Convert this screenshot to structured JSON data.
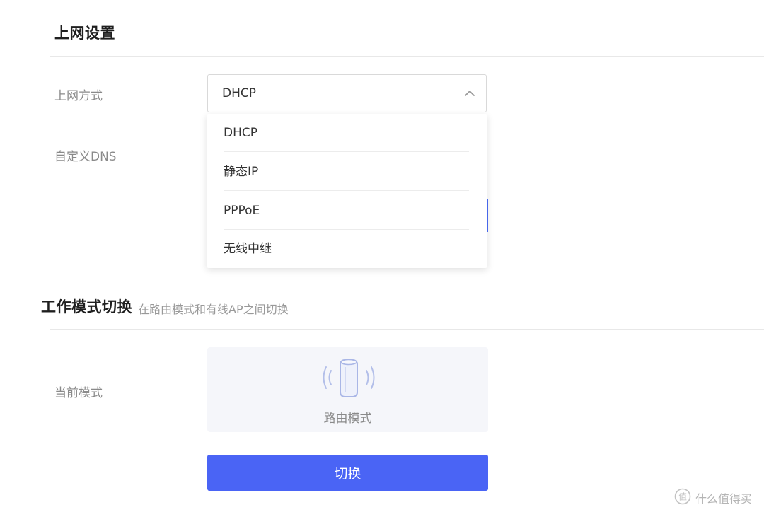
{
  "internet_settings": {
    "title": "上网设置",
    "connection_type": {
      "label": "上网方式",
      "selected": "DHCP",
      "options": [
        "DHCP",
        "静态IP",
        "PPPoE",
        "无线中继"
      ]
    },
    "custom_dns_label": "自定义DNS"
  },
  "work_mode": {
    "title": "工作模式切换",
    "subtitle": "在路由模式和有线AP之间切换",
    "current_mode_label": "当前模式",
    "current_mode": "路由模式",
    "switch_button": "切换"
  },
  "watermark": {
    "text": "什么值得买"
  },
  "colors": {
    "primary": "#4a64f5",
    "icon_blue": "#a9b6e6",
    "card_bg": "#f5f6fa"
  },
  "icons": {
    "dropdown_arrow": "chevron-up-icon",
    "mode": "router-icon"
  }
}
